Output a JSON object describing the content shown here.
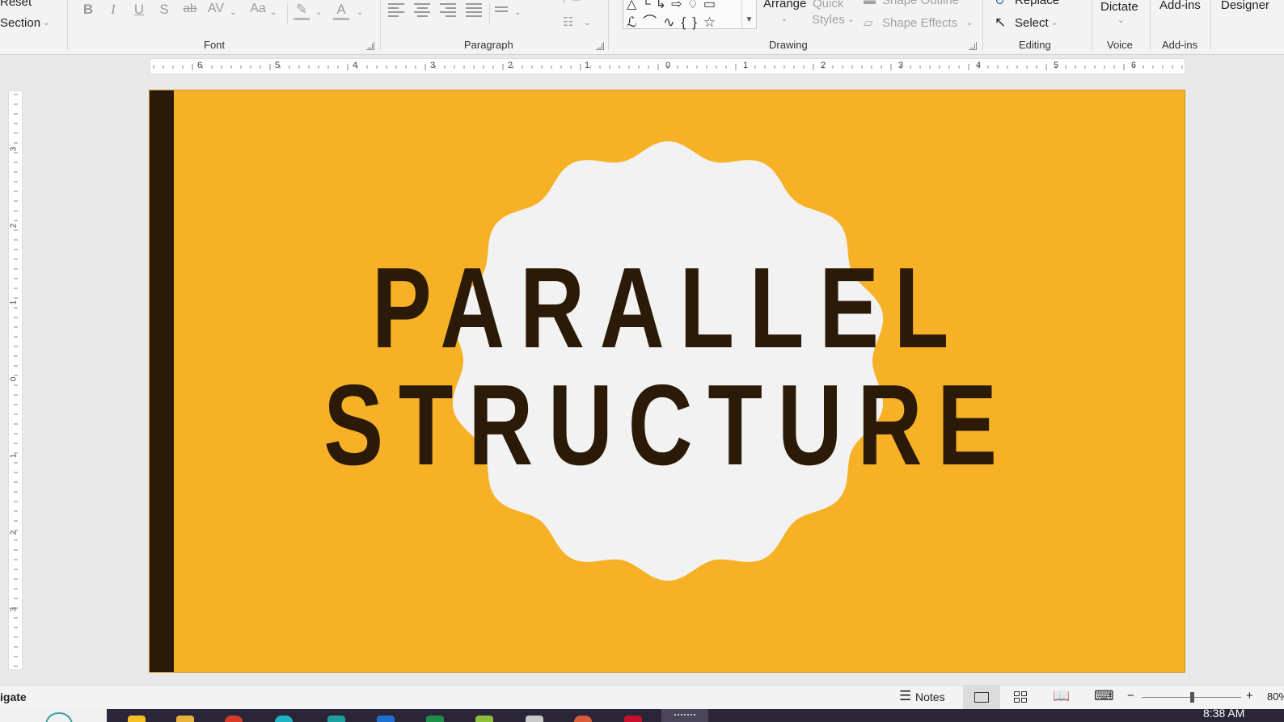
{
  "ribbon": {
    "slides_group": {
      "reset_label": "Reset",
      "section_label": "Section"
    },
    "font_group": {
      "label": "Font",
      "buttons": {
        "bold": "B",
        "italic": "I",
        "underline": "U",
        "shadow": "S",
        "strikethrough": "ab",
        "spacing": "AV",
        "case": "Aa",
        "highlight": "✎",
        "font_color": "A"
      }
    },
    "paragraph_group": {
      "label": "Paragraph"
    },
    "drawing_group": {
      "label": "Drawing",
      "arrange_label": "Arrange",
      "quick_styles_label_1": "Quick",
      "quick_styles_label_2": "Styles",
      "shape_outline_label": "Shape Outline",
      "shape_effects_label": "Shape Effects",
      "shape_glyphs_row1": [
        "△",
        "└",
        "↳",
        "⇨",
        "♢",
        "▭"
      ],
      "shape_glyphs_row2": [
        "ℒ",
        "⌒",
        "∿",
        "{",
        "}",
        "☆"
      ]
    },
    "editing_group": {
      "label": "Editing",
      "replace_label": "Replace",
      "select_label": "Select"
    },
    "voice_group": {
      "label": "Voice",
      "dictate_label": "Dictate"
    },
    "addins_group": {
      "label": "Add-ins",
      "addins_label": "Add-ins"
    },
    "designer_label": "Designer"
  },
  "ruler": {
    "horizontal_numbers": [
      "6",
      "5",
      "4",
      "3",
      "2",
      "1",
      "0",
      "1",
      "2",
      "3",
      "4",
      "5",
      "6"
    ],
    "vertical_numbers": [
      "3",
      "2",
      "1",
      "0",
      "1",
      "2",
      "3"
    ]
  },
  "slide": {
    "title_line_1": "PARALLEL",
    "title_line_2": "STRUCTURE",
    "colors": {
      "background": "#f7b126",
      "bar": "#2a1a08",
      "badge": "#f2f2f2",
      "text": "#2b1a07"
    }
  },
  "status_bar": {
    "navigate_label": "igate",
    "notes_label": "Notes",
    "zoom_minus": "−",
    "zoom_plus": "+",
    "zoom_level": "80%",
    "zoom_fraction": 0.5
  },
  "taskbar": {
    "time": "8:38 AM"
  }
}
